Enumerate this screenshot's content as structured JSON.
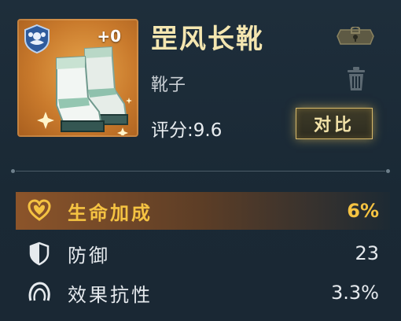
{
  "item": {
    "name": "罡风长靴",
    "type": "靴子",
    "level": "+0",
    "score": "评分:9.6",
    "compare_label": "对比"
  },
  "main_stat": {
    "name": "生命加成",
    "value": "6%"
  },
  "sub_stats": [
    {
      "name": "防御",
      "value": "23",
      "icon": "shield-icon"
    },
    {
      "name": "效果抗性",
      "value": "3.3%",
      "icon": "resistance-icon"
    }
  ],
  "icons": {
    "main_stat": "heart-icon",
    "set": "set-emblem-icon",
    "lock": "lock-icon",
    "discard": "trash-icon"
  },
  "colors": {
    "title": "#f4e6b0",
    "main_stat": "#f5c342",
    "thumb_bg": "#c97a2c",
    "panel_bg": "#1b2a36"
  }
}
